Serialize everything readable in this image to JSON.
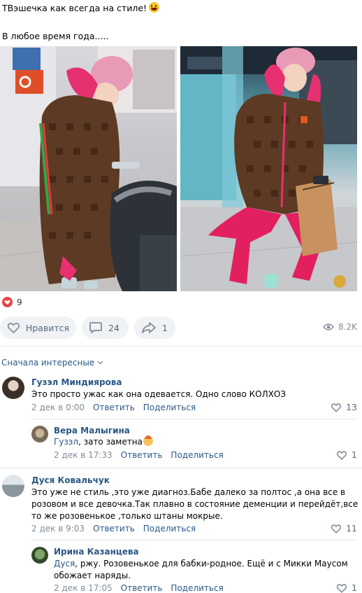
{
  "post": {
    "line1": "ТВэшечка как всегда на стиле!",
    "line2": "В любое время года.....",
    "emoji": "grinning-face-emoji"
  },
  "reactions": {
    "count": "9"
  },
  "actions": {
    "like_label": "Нравится",
    "comments_count": "24",
    "shares_count": "1",
    "views": "8.2K"
  },
  "comments_sort": {
    "label": "Сначала интересные"
  },
  "comments": [
    {
      "author": "Гузэл Миндиярова",
      "text": "Это просто ужас как она одевается. Одно слово КОЛХОЗ",
      "date": "2 дек в 0:00",
      "reply_label": "Ответить",
      "share_label": "Поделиться",
      "likes": "13"
    },
    {
      "author": "Вера Малыгина",
      "reply_to": "Гузэл",
      "text": ", зато заметна",
      "date": "2 дек в 17:33",
      "reply_label": "Ответить",
      "share_label": "Поделиться",
      "likes": "1"
    },
    {
      "author": "Дуся Ковальчук",
      "text_lines": [
        "Это уже не стиль ,это уже диагноз.Бабе далеко за полтос ,а она все в",
        "розовом и все девочка.Так плавно в состояние деменции и перейдёт,все",
        "то же розовенькое ,только штаны мокрые."
      ],
      "date": "2 дек в 9:03",
      "reply_label": "Ответить",
      "share_label": "Поделиться",
      "likes": "11"
    },
    {
      "author": "Ирина Казанцева",
      "reply_to": "Дуся",
      "text_line1": ", ржу. Розовенькое для бабки-родное. Ещё и с Микки Маусом",
      "text_line2": "обожает наряды.",
      "date": "2 дек в 17:05",
      "reply_label": "Ответить",
      "share_label": "Поделиться",
      "likes": "1"
    }
  ],
  "colors": {
    "link": "#2a5885",
    "muted": "#818c99",
    "button_bg": "#f0f2f5",
    "heart_red": "#e64646"
  }
}
